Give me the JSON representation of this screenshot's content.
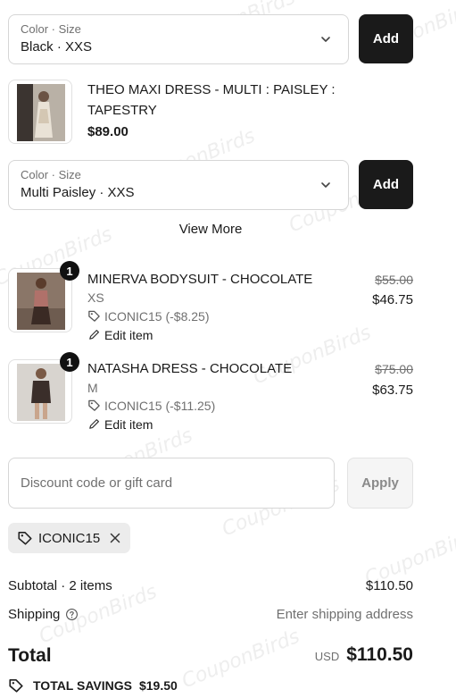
{
  "variant_select_1": {
    "label": "Color · Size",
    "value": "Black · XXS",
    "add_label": "Add"
  },
  "upsell_product": {
    "name_line1": "THEO MAXI DRESS - MULTI : PAISLEY :",
    "name_line2": "TAPESTRY",
    "price": "$89.00"
  },
  "variant_select_2": {
    "label": "Color · Size",
    "value": "Multi Paisley · XXS",
    "add_label": "Add"
  },
  "view_more": "View More",
  "cart_items": [
    {
      "quantity": "1",
      "name": "MINERVA BODYSUIT - CHOCOLATE",
      "variant": "XS",
      "discount": "ICONIC15 (-$8.25)",
      "edit_label": "Edit item",
      "original_price": "$55.00",
      "final_price": "$46.75"
    },
    {
      "quantity": "1",
      "name": "NATASHA DRESS - CHOCOLATE",
      "variant": "M",
      "discount": "ICONIC15 (-$11.25)",
      "edit_label": "Edit item",
      "original_price": "$75.00",
      "final_price": "$63.75"
    }
  ],
  "discount_field": {
    "placeholder": "Discount code or gift card",
    "value": "",
    "apply_label": "Apply"
  },
  "applied_code": "ICONIC15",
  "summary": {
    "subtotal_label": "Subtotal · 2 items",
    "subtotal_value": "$110.50",
    "shipping_label": "Shipping",
    "shipping_value": "Enter shipping address",
    "total_label": "Total",
    "currency": "USD",
    "total_value": "$110.50",
    "savings_label": "TOTAL SAVINGS",
    "savings_value": "$19.50"
  },
  "watermark_text": "CouponBirds",
  "icons": [
    "chevron-down-icon",
    "tag-icon",
    "pencil-icon",
    "close-icon",
    "help-circle-icon"
  ],
  "colors": {
    "button_dark": "#1a1a1a",
    "muted_text": "#707070",
    "border": "#d6d6d6",
    "chip_bg": "#ececec"
  }
}
